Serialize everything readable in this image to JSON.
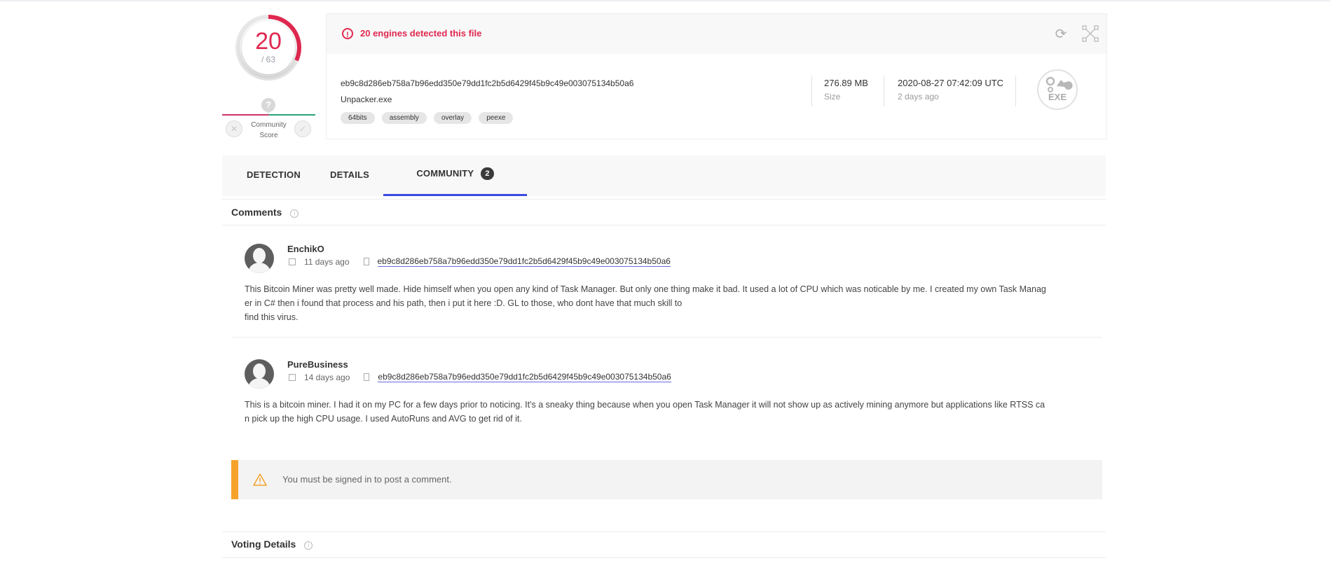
{
  "detection": {
    "positives": "20",
    "total": "/ 63",
    "alert_text": "20 engines detected this file",
    "accent_color": "#e02850"
  },
  "community_score": {
    "label_line1": "Community",
    "label_line2": "Score",
    "marker": "?"
  },
  "file": {
    "sha256": "eb9c8d286eb758a7b96edd350e79dd1fc2b5d6429f45b9c49e003075134b50a6",
    "name": "Unpacker.exe",
    "tags": [
      "64bits",
      "assembly",
      "overlay",
      "peexe"
    ],
    "size_value": "276.89 MB",
    "size_label": "Size",
    "date_value": "2020-08-27 07:42:09 UTC",
    "date_label": "2 days ago",
    "type_label": "EXE"
  },
  "tabs": {
    "detection": "DETECTION",
    "details": "DETAILS",
    "community": "COMMUNITY",
    "community_count": "2"
  },
  "comments_section": {
    "title": "Comments",
    "items": [
      {
        "author": "EnchikO",
        "time": "11 days ago",
        "link": "eb9c8d286eb758a7b96edd350e79dd1fc2b5d6429f45b9c49e003075134b50a6",
        "body_line1": "This Bitcoin Miner was pretty well made. Hide himself when you open any kind of Task Manager. But only one thing make it bad. It used a lot of CPU which was noticable by me. I created my own Task Manag",
        "body_line2": "er in C# then i found that process and his path, then i put it here :D. GL to those, who dont have that much skill to",
        "body_line3": "find this virus."
      },
      {
        "author": "PureBusiness",
        "time": "14 days ago",
        "link": "eb9c8d286eb758a7b96edd350e79dd1fc2b5d6429f45b9c49e003075134b50a6",
        "body_line1": "This is a bitcoin miner. I had it on my PC for a few days prior to noticing. It's a sneaky thing because when you open Task Manager it will not show up as actively mining anymore but applications like RTSS ca",
        "body_line2": "n pick up the high CPU usage. I used AutoRuns and AVG to get rid of it."
      }
    ]
  },
  "signin_notice": "You must be signed in to post a comment.",
  "voting_section": {
    "title": "Voting Details"
  }
}
